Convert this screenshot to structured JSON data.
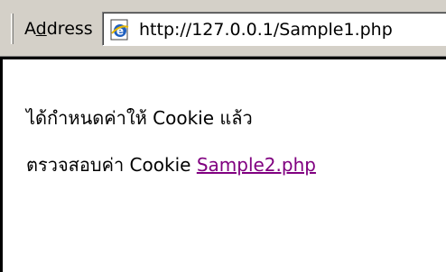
{
  "address_bar": {
    "label_prefix": "A",
    "label_accel": "d",
    "label_suffix": "dress",
    "url": "http://127.0.0.1/Sample1.php",
    "icon": "ie-page-icon"
  },
  "page": {
    "message": "ได้กำหนดค่าให้ Cookie แล้ว",
    "check_prefix": "ตรวจสอบค่า Cookie",
    "link_text": "Sample2.php",
    "link_color": "#800080"
  }
}
